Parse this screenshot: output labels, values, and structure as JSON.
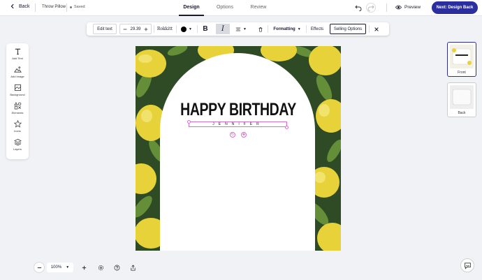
{
  "header": {
    "back_label": "Back",
    "project_name": "Throw Pillow",
    "saved_label": "Saved",
    "tabs": [
      {
        "label": "Design",
        "active": true
      },
      {
        "label": "Options",
        "active": false
      },
      {
        "label": "Review",
        "active": false
      }
    ],
    "icons": {
      "undo": "undo-icon",
      "redo": "redo-icon",
      "preview": "eye-icon"
    },
    "preview_label": "Preview",
    "next_label": "Next: Design Back",
    "accent_color": "#2b2e9e"
  },
  "toolbar": {
    "edit_text_label": "Edit text",
    "font_size": "29.39",
    "font_name": "Rokkitt",
    "text_color": "#000000",
    "bold_label": "B",
    "italic_label": "I",
    "formatting_label": "Formatting",
    "effects_label": "Effects",
    "selling_options_label": "Selling Options",
    "icons": {
      "minus": "minus-icon",
      "plus": "plus-icon",
      "align": "align-icon",
      "delete": "trash-icon",
      "close": "close-icon"
    }
  },
  "sidebar": {
    "items": [
      {
        "label": "Add Text",
        "icon": "text-icon"
      },
      {
        "label": "Add Image",
        "icon": "image-icon"
      },
      {
        "label": "Background",
        "icon": "background-icon"
      },
      {
        "label": "Elements",
        "icon": "shapes-icon"
      },
      {
        "label": "Icons",
        "icon": "star-icon"
      },
      {
        "label": "Layers",
        "icon": "layers-icon"
      }
    ]
  },
  "canvas": {
    "title": "HAPPY BIRTHDAY",
    "subtitle": "JENNIFER",
    "background_pattern": "lemons",
    "arch_color": "#ffffff"
  },
  "sides": [
    {
      "label": "Front",
      "active": true
    },
    {
      "label": "Back",
      "active": false
    }
  ],
  "bottom": {
    "zoom_level": "100%",
    "icons": {
      "zoom_out": "minus-icon",
      "zoom_in": "plus-icon",
      "settings": "gear-icon",
      "help": "help-icon",
      "share": "share-icon",
      "chat": "chat-icon"
    }
  }
}
